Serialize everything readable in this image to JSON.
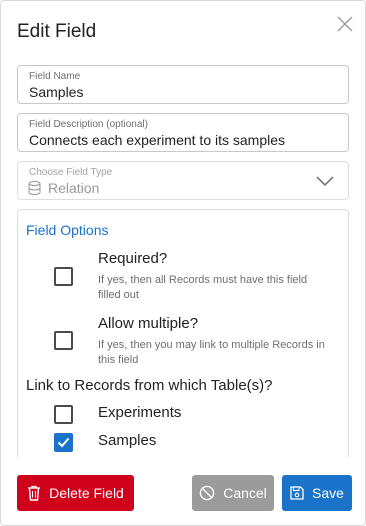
{
  "dialog": {
    "title": "Edit Field",
    "close_icon": "close-icon"
  },
  "fields": {
    "name": {
      "label": "Field Name",
      "value": "Samples"
    },
    "description": {
      "label": "Field Description (optional)",
      "value": "Connects each experiment to its samples"
    },
    "type": {
      "label": "Choose Field Type",
      "value": "Relation",
      "icon": "database-icon",
      "disabled": true
    }
  },
  "options": {
    "title": "Field Options",
    "required": {
      "label": "Required?",
      "description": "If yes, then all Records must have this field filled out",
      "checked": false
    },
    "allow_multiple": {
      "label": "Allow multiple?",
      "description": "If yes, then you may link to multiple Records in this field",
      "checked": false
    },
    "link_title": "Link to Records from which Table(s)?",
    "tables": [
      {
        "label": "Experiments",
        "checked": false
      },
      {
        "label": "Samples",
        "checked": true
      }
    ]
  },
  "actions": {
    "delete_label": "Delete Field",
    "cancel_label": "Cancel",
    "save_label": "Save"
  },
  "colors": {
    "accent": "#1a73c8",
    "danger": "#d0021b",
    "muted": "#9b9b9b"
  }
}
